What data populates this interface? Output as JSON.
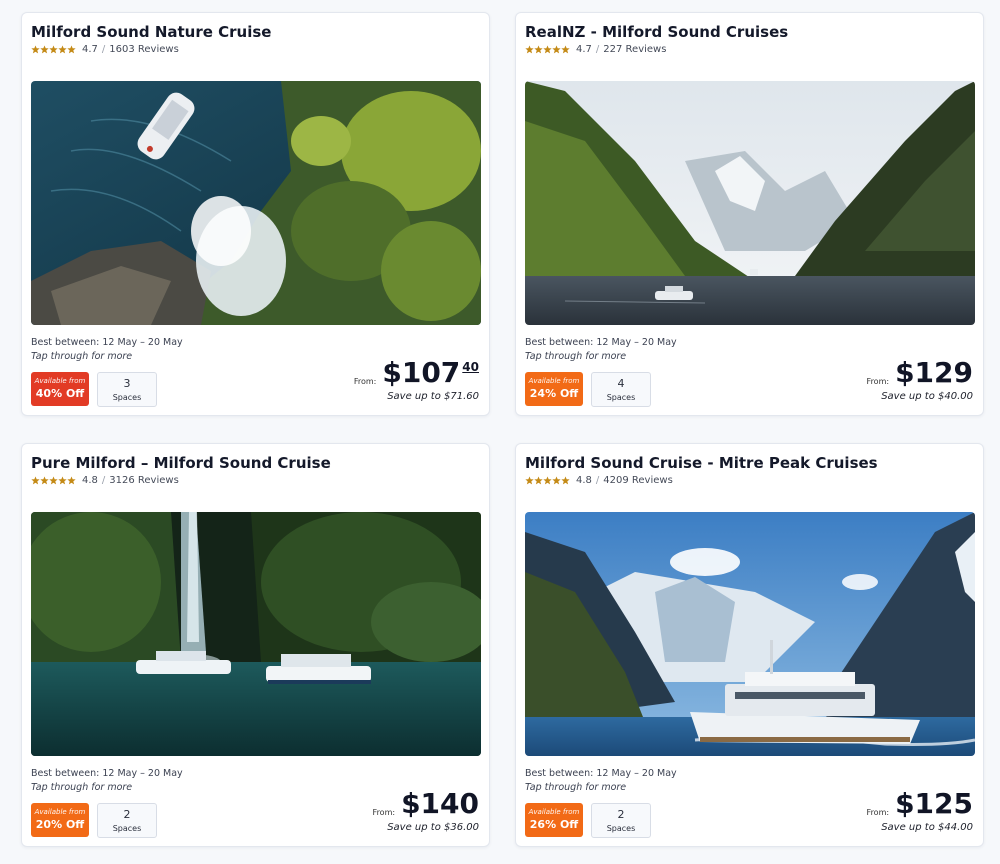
{
  "colors": {
    "badge_red": "#e23b25",
    "badge_orange": "#f26a16",
    "star": "#c48a16"
  },
  "cards": [
    {
      "title": "Milford Sound Nature Cruise",
      "rating": "4.7",
      "rating_value": 4.7,
      "reviews": "1603 Reviews",
      "best_between": "Best between: 12 May – 20 May",
      "tap_through": "Tap through for more",
      "discount_small": "Available from",
      "discount": "40% Off",
      "discount_color": "red",
      "spaces_count": "3",
      "spaces_label": "Spaces",
      "from_label": "From:",
      "price": "$107",
      "price_cents": "40",
      "save": "Save up to $71.60",
      "photo": "aerial view of cruise boat beside waterfall and forested cliff"
    },
    {
      "title": "RealNZ - Milford Sound Cruises",
      "rating": "4.7",
      "rating_value": 4.7,
      "reviews": "227 Reviews",
      "best_between": "Best between: 12 May – 20 May",
      "tap_through": "Tap through for more",
      "discount_small": "Available from",
      "discount": "24% Off",
      "discount_color": "orange",
      "spaces_count": "4",
      "spaces_label": "Spaces",
      "from_label": "From:",
      "price": "$129",
      "price_cents": "",
      "save": "Save up to $40.00",
      "photo": "fiord with misty green mountains and small boat"
    },
    {
      "title": "Pure Milford – Milford Sound Cruise",
      "rating": "4.8",
      "rating_value": 4.8,
      "reviews": "3126 Reviews",
      "best_between": "Best between: 12 May – 20 May",
      "tap_through": "Tap through for more",
      "discount_small": "Available from",
      "discount": "20% Off",
      "discount_color": "orange",
      "spaces_count": "2",
      "spaces_label": "Spaces",
      "from_label": "From:",
      "price": "$140",
      "price_cents": "",
      "save": "Save up to $36.00",
      "photo": "two cruise boats near tall waterfall on dark green water"
    },
    {
      "title": "Milford Sound Cruise - Mitre Peak Cruises",
      "rating": "4.8",
      "rating_value": 4.8,
      "reviews": "4209 Reviews",
      "best_between": "Best between: 12 May – 20 May",
      "tap_through": "Tap through for more",
      "discount_small": "Available from",
      "discount": "26% Off",
      "discount_color": "orange",
      "spaces_count": "2",
      "spaces_label": "Spaces",
      "from_label": "From:",
      "price": "$125",
      "price_cents": "",
      "save": "Save up to $44.00",
      "photo": "cruise boat with snowy mountains and blue sky"
    }
  ]
}
